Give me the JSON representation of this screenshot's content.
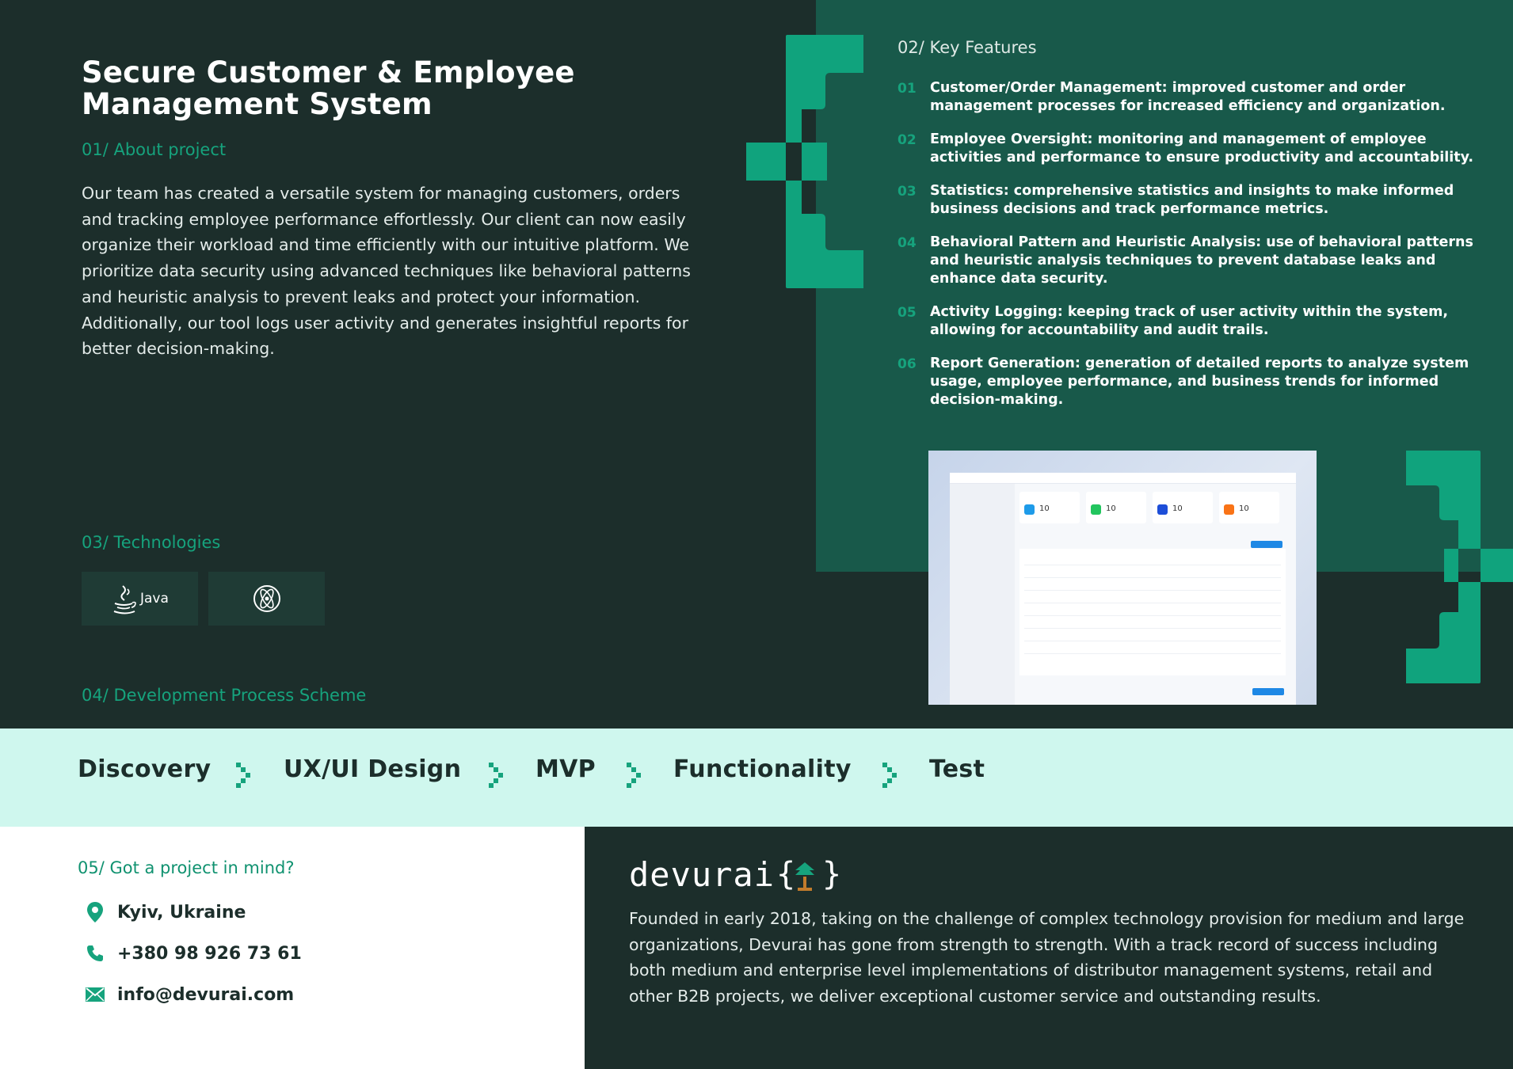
{
  "header": {
    "title": "Secure Customer & Employee Management System"
  },
  "about": {
    "label": "01/ About project",
    "text": "Our team has created a versatile system for managing customers, orders and tracking employee performance effortlessly. Our client can now easily organize their workload and time efficiently with our intuitive platform. We prioritize data security using advanced techniques like behavioral patterns and heuristic analysis to prevent leaks and protect your information. Additionally, our tool logs user activity and generates insightful reports for better decision-making."
  },
  "features": {
    "label": "02/ Key Features",
    "items": [
      {
        "num": "01",
        "text": "Customer/Order Management: improved customer and order management processes for increased efficiency and organization."
      },
      {
        "num": "02",
        "text": "Employee Oversight: monitoring and management of employee activities and performance to ensure productivity and accountability."
      },
      {
        "num": "03",
        "text": "Statistics: comprehensive statistics and insights to make informed business decisions and track performance metrics."
      },
      {
        "num": "04",
        "text": "Behavioral Pattern and Heuristic Analysis: use of behavioral patterns and heuristic analysis techniques to prevent database leaks and enhance data security."
      },
      {
        "num": "05",
        "text": "Activity Logging: keeping track of user activity within the system, allowing for accountability and audit trails."
      },
      {
        "num": "06",
        "text": "Report Generation: generation of detailed reports to analyze system usage, employee performance, and business trends for informed decision-making."
      }
    ]
  },
  "screenshot": {
    "cards": [
      {
        "value": "10",
        "color": "#1e9be9"
      },
      {
        "value": "10",
        "color": "#22c55e"
      },
      {
        "value": "10",
        "color": "#1d4ed8"
      },
      {
        "value": "10",
        "color": "#f97316"
      }
    ]
  },
  "technologies": {
    "label": "03/ Technologies",
    "items": [
      {
        "name": "Java",
        "icon": "java-icon"
      },
      {
        "name": "",
        "icon": "electron-icon"
      }
    ]
  },
  "process": {
    "label": "04/ Development Process Scheme",
    "steps": [
      "Discovery",
      "UX/UI Design",
      "MVP",
      "Functionality",
      "Test"
    ]
  },
  "contact": {
    "label": "05/ Got a project in mind?",
    "location": "Kyiv, Ukraine",
    "phone": "+380 98 926 73 61",
    "email": "info@devurai.com"
  },
  "company": {
    "logo_text": "devurai",
    "description": "Founded in early 2018, taking on the challenge of complex technology provision for medium and large organizations, Devurai has gone from strength to strength. With a track record of success including both medium and enterprise level implementations of distributor management systems, retail and other B2B projects, we deliver exceptional customer service and outstanding results."
  },
  "colors": {
    "dark": "#1c2e2b",
    "panel_green": "#18594a",
    "accent": "#16a37d",
    "process_bg": "#cff7ee"
  }
}
